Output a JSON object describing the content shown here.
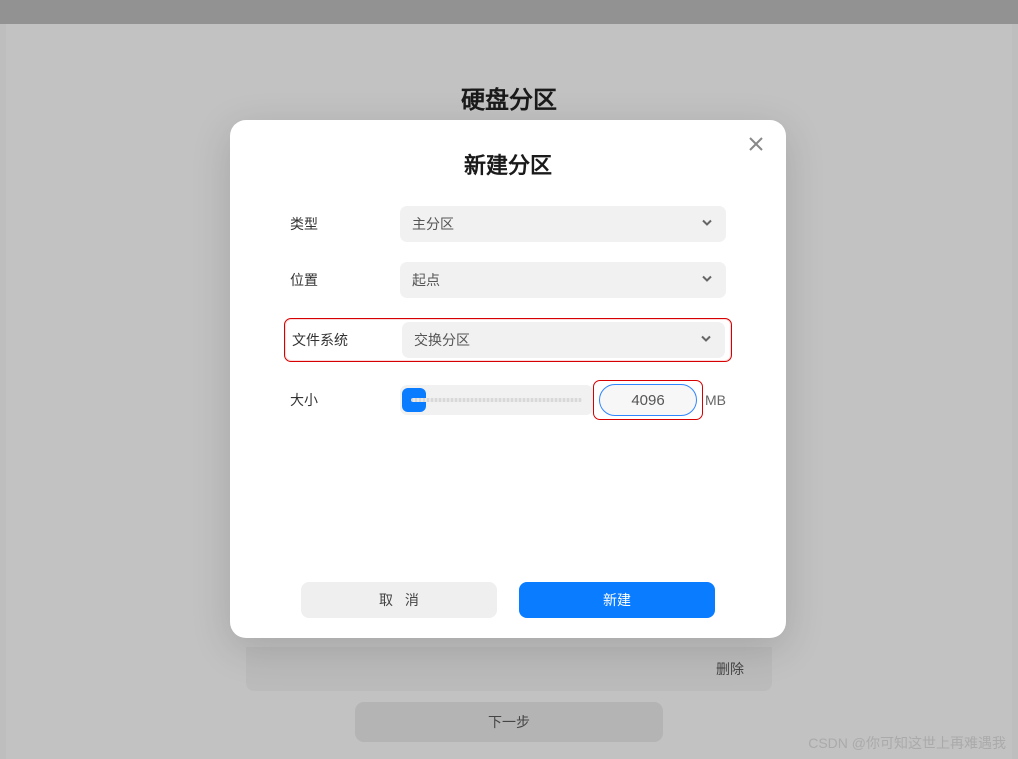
{
  "page": {
    "title": "硬盘分区"
  },
  "modal": {
    "title": "新建分区",
    "fields": {
      "type": {
        "label": "类型",
        "value": "主分区"
      },
      "position": {
        "label": "位置",
        "value": "起点"
      },
      "filesystem": {
        "label": "文件系统",
        "value": "交换分区"
      },
      "size": {
        "label": "大小",
        "value": "4096",
        "unit": "MB"
      }
    },
    "buttons": {
      "cancel": "取 消",
      "create": "新建"
    }
  },
  "background": {
    "delete_label": "删除",
    "next_label": "下一步"
  },
  "watermark": "CSDN @你可知这世上再难遇我"
}
